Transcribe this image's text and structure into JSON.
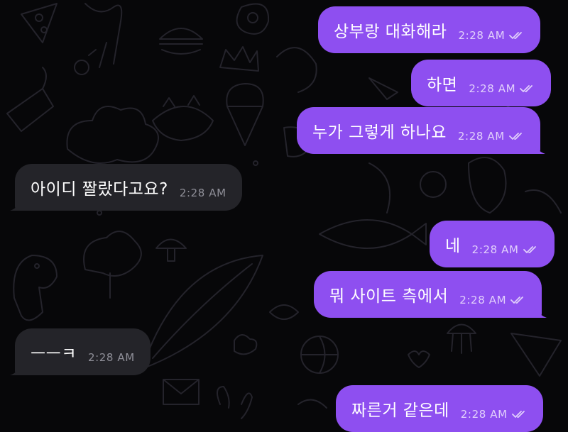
{
  "colors": {
    "outgoing_bubble": "#8e4ff0",
    "incoming_bubble": "#242429",
    "background": "#070709",
    "doodle_line": "#24232b"
  },
  "icons": {
    "read_receipt": "double-check-icon"
  },
  "messages": [
    {
      "direction": "outgoing",
      "text": "상부랑 대화해라",
      "time": "2:28 AM",
      "read": true
    },
    {
      "direction": "outgoing",
      "text": "하면",
      "time": "2:28 AM",
      "read": true
    },
    {
      "direction": "outgoing",
      "text": "누가 그렇게 하나요",
      "time": "2:28 AM",
      "read": true
    },
    {
      "direction": "incoming",
      "text": "아이디 짤랐다고요?",
      "time": "2:28 AM"
    },
    {
      "direction": "outgoing",
      "text": "네",
      "time": "2:28 AM",
      "read": true
    },
    {
      "direction": "outgoing",
      "text": "뭐 사이트 측에서",
      "time": "2:28 AM",
      "read": true
    },
    {
      "direction": "incoming",
      "text": "ㅡㅡㅋ",
      "time": "2:28 AM"
    },
    {
      "direction": "outgoing",
      "text": "짜른거 같은데",
      "time": "2:28 AM",
      "read": true
    }
  ]
}
